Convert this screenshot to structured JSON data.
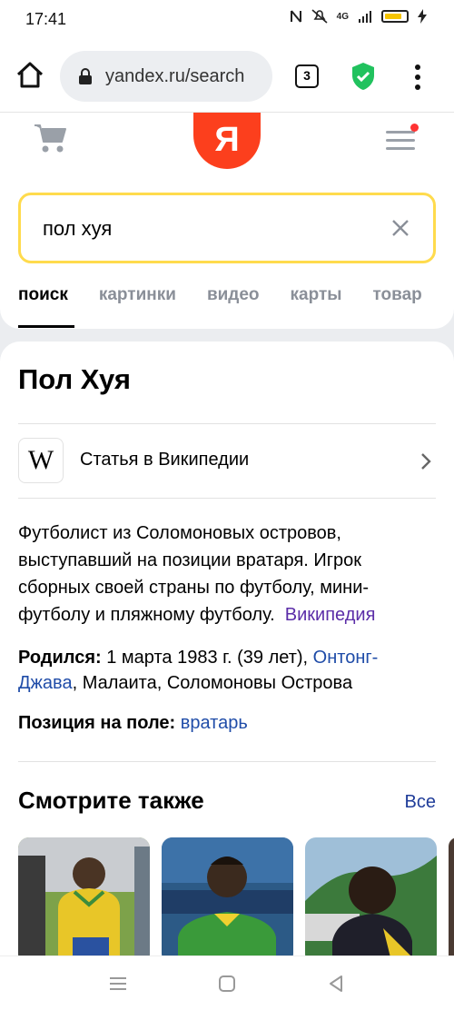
{
  "status": {
    "time": "17:41",
    "network": "4G"
  },
  "browser": {
    "url": "yandex.ru/search",
    "tab_count": "3"
  },
  "search": {
    "query": "пол хуя",
    "logo": "Я"
  },
  "tabs": [
    "поиск",
    "картинки",
    "видео",
    "карты",
    "товар"
  ],
  "entity": {
    "title": "Пол Хуя",
    "wiki_label": "Статья в Википедии",
    "wiki_icon": "W",
    "description": "Футболист из Соломоновых островов, выступавший на позиции вратаря. Игрок сборных своей страны по футболу, мини-футболу и пляжному футболу.",
    "source": "Википедия",
    "born_label": "Родился:",
    "born_text": "1 марта 1983 г. (39 лет),",
    "born_link": "Онтонг-Джава",
    "born_rest": ", Малаита, Соломоновы Острова",
    "position_label": "Позиция на поле:",
    "position_link": "вратарь"
  },
  "see_also": {
    "title": "Смотрите также",
    "all": "Все"
  },
  "colors": {
    "accent": "#ffdb4d",
    "logo": "#fc3f1d",
    "link": "#5b2da8",
    "shield": "#21c25e"
  }
}
